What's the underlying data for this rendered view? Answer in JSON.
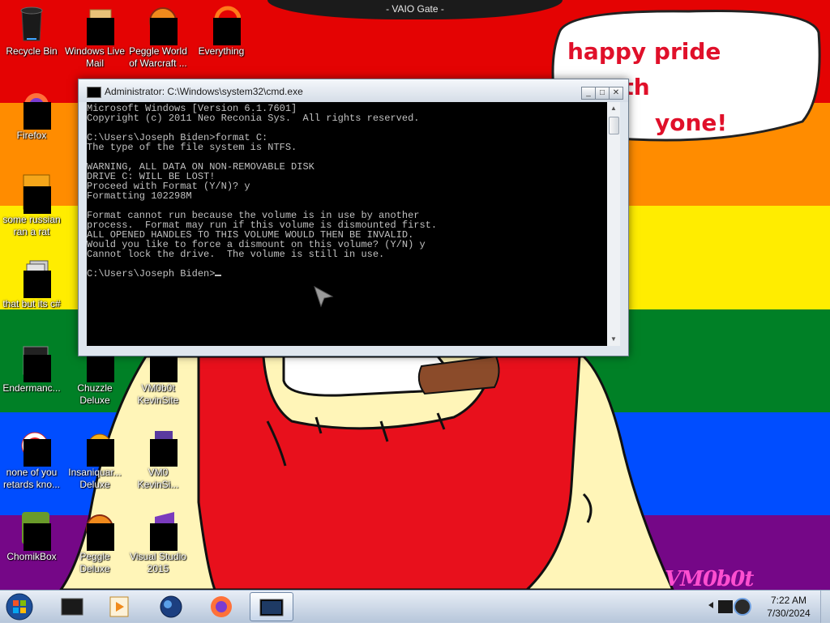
{
  "desktop": {
    "wallpaper_colors": [
      "#e40303",
      "#ff8c00",
      "#ffed00",
      "#008026",
      "#004dff",
      "#750787"
    ],
    "top_banner": "- VAIO Gate -",
    "bubble_lines": [
      "happy pride month",
      "yone!"
    ],
    "watermark": "VM0b0t",
    "icons": [
      {
        "label_lines": [
          "Recycle Bin"
        ],
        "icon": "recycle-bin-icon",
        "censored": false
      },
      {
        "label_lines": [
          "Windows Live",
          "Mail"
        ],
        "icon": "windows-live-mail-icon",
        "censored": true
      },
      {
        "label_lines": [
          "Peggle World",
          "of Warcraft ..."
        ],
        "icon": "peggle-icon",
        "censored": true
      },
      {
        "label_lines": [
          "Everything"
        ],
        "icon": "everything-search-icon",
        "censored": true
      },
      {
        "label_lines": [
          "Firefox"
        ],
        "icon": "firefox-icon",
        "censored": true
      },
      {
        "label_lines": [
          "some russian",
          "ran a rat"
        ],
        "icon": "program-icon",
        "censored": true
      },
      {
        "label_lines": [
          "that but its c#"
        ],
        "icon": "program-icon",
        "censored": true
      },
      {
        "label_lines": [
          "Endermanc..."
        ],
        "icon": "program-icon",
        "censored": true
      },
      {
        "label_lines": [
          "Chuzzle",
          "Deluxe"
        ],
        "icon": "chuzzle-icon",
        "censored": true
      },
      {
        "label_lines": [
          "VM0b0t",
          "KevinSite"
        ],
        "icon": "program-icon",
        "censored": true
      },
      {
        "label_lines": [
          "none of you",
          "retards kno..."
        ],
        "icon": "program-icon",
        "censored": true
      },
      {
        "label_lines": [
          "Insaniquar...",
          "Deluxe"
        ],
        "icon": "insaniquarium-icon",
        "censored": true
      },
      {
        "label_lines": [
          "VM0",
          "KevinSi..."
        ],
        "icon": "program-icon",
        "censored": true
      },
      {
        "label_lines": [
          "ChomikBox"
        ],
        "icon": "chomikbox-icon",
        "censored": true
      },
      {
        "label_lines": [
          "Peggle Deluxe"
        ],
        "icon": "peggle-icon",
        "censored": true
      },
      {
        "label_lines": [
          "Visual Studio",
          "2015"
        ],
        "icon": "visual-studio-icon",
        "censored": true
      }
    ]
  },
  "cmd": {
    "title": "Administrator: C:\\Windows\\system32\\cmd.exe",
    "buttons": {
      "minimize": "_",
      "maximize": "□",
      "close": "✕"
    },
    "lines": [
      "Microsoft Windows [Version 6.1.7601]",
      "Copyright (c) 2011 Neo Reconia Sys.  All rights reserved.",
      "",
      "C:\\Users\\Joseph Biden>format C:",
      "The type of the file system is NTFS.",
      "",
      "WARNING, ALL DATA ON NON-REMOVABLE DISK",
      "DRIVE C: WILL BE LOST!",
      "Proceed with Format (Y/N)? y",
      "Formatting 102298M",
      "",
      "Format cannot run because the volume is in use by another",
      "process.  Format may run if this volume is dismounted first.",
      "ALL OPENED HANDLES TO THIS VOLUME WOULD THEN BE INVALID.",
      "Would you like to force a dismount on this volume? (Y/N) y",
      "Cannot lock the drive.  The volume is still in use.",
      "",
      "C:\\Users\\Joseph Biden>"
    ]
  },
  "taskbar": {
    "start_icon": "windows-orb-icon",
    "pinned": [
      "explorer-icon",
      "media-player-icon",
      "globe-icon",
      "firefox-icon",
      "cmd-icon"
    ],
    "active": "cmd-icon",
    "tray_icons": [
      "show-hidden-icons-icon",
      "network-icon"
    ],
    "clock": {
      "time": "7:22 AM",
      "date": "7/30/2024"
    }
  }
}
